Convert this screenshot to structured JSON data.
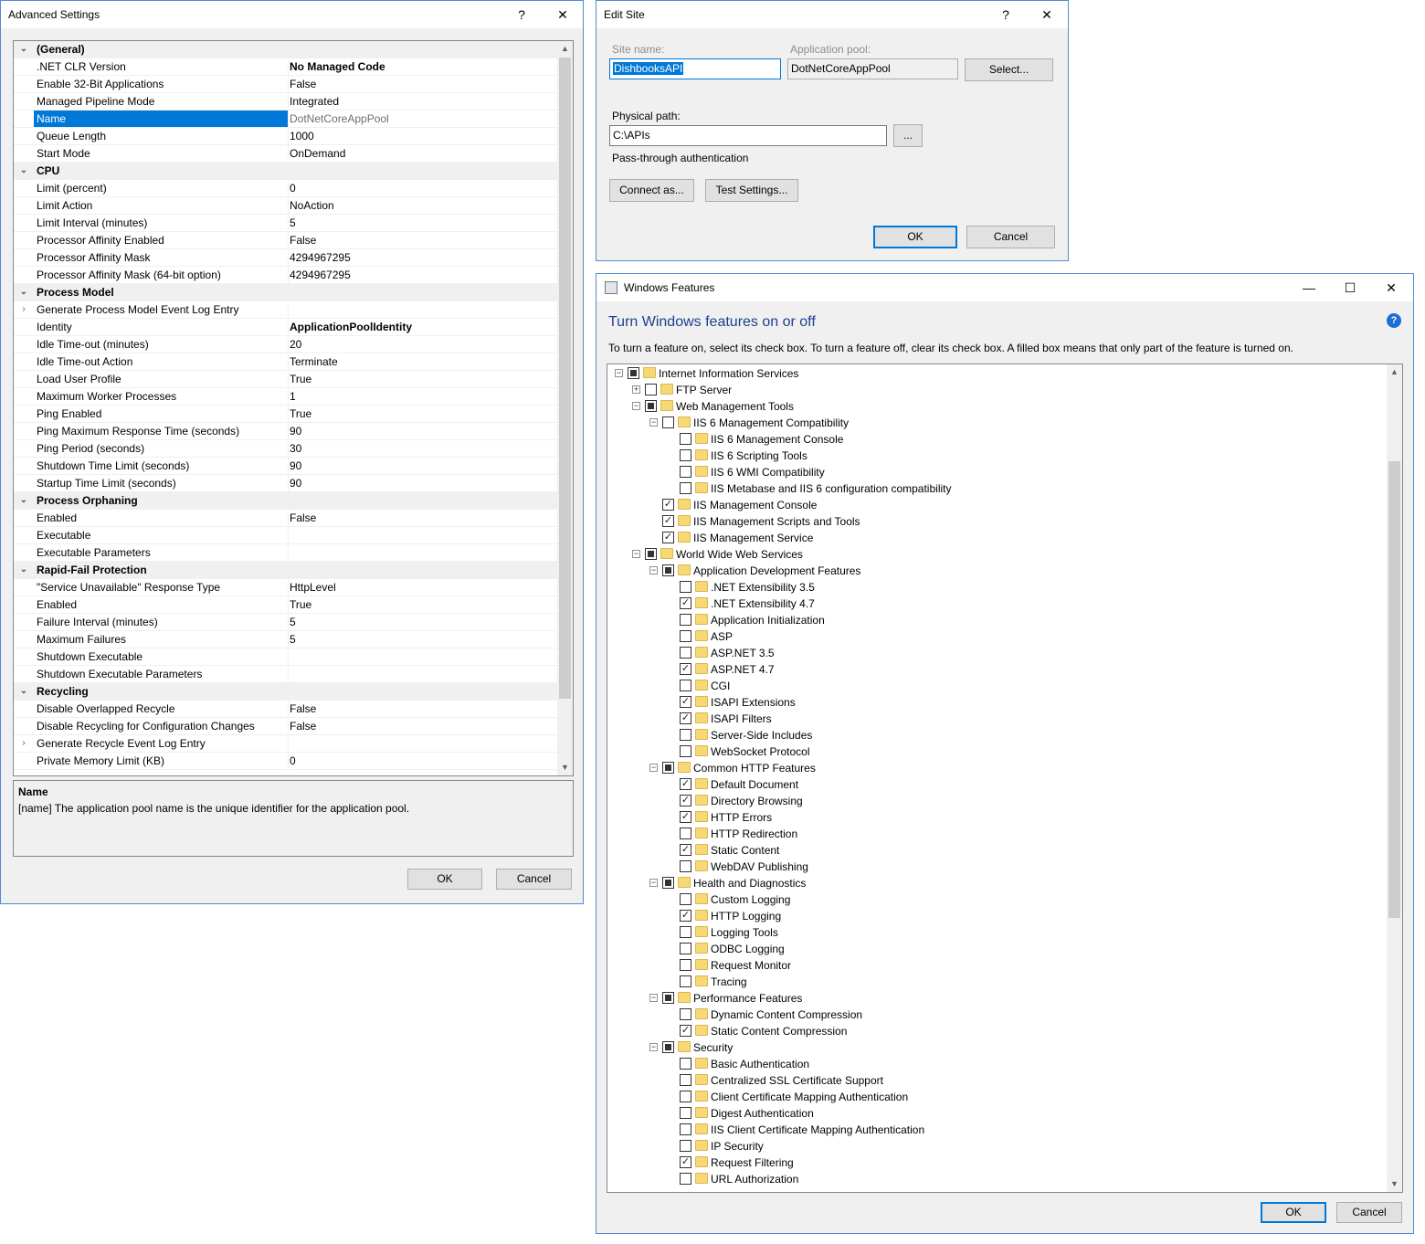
{
  "advanced_settings": {
    "title": "Advanced Settings",
    "help": "?",
    "close": "✕",
    "rows": [
      {
        "type": "cat",
        "name": "(General)"
      },
      {
        "name": ".NET CLR Version",
        "value": "No Managed Code",
        "bold": true
      },
      {
        "name": "Enable 32-Bit Applications",
        "value": "False"
      },
      {
        "name": "Managed Pipeline Mode",
        "value": "Integrated"
      },
      {
        "name": "Name",
        "value": "DotNetCoreAppPool",
        "selected": true
      },
      {
        "name": "Queue Length",
        "value": "1000"
      },
      {
        "name": "Start Mode",
        "value": "OnDemand"
      },
      {
        "type": "cat",
        "name": "CPU"
      },
      {
        "name": "Limit (percent)",
        "value": "0"
      },
      {
        "name": "Limit Action",
        "value": "NoAction"
      },
      {
        "name": "Limit Interval (minutes)",
        "value": "5"
      },
      {
        "name": "Processor Affinity Enabled",
        "value": "False"
      },
      {
        "name": "Processor Affinity Mask",
        "value": "4294967295"
      },
      {
        "name": "Processor Affinity Mask (64-bit option)",
        "value": "4294967295"
      },
      {
        "type": "cat",
        "name": "Process Model"
      },
      {
        "name": "Generate Process Model Event Log Entry",
        "value": "",
        "collapsed": true
      },
      {
        "name": "Identity",
        "value": "ApplicationPoolIdentity",
        "bold": true
      },
      {
        "name": "Idle Time-out (minutes)",
        "value": "20"
      },
      {
        "name": "Idle Time-out Action",
        "value": "Terminate"
      },
      {
        "name": "Load User Profile",
        "value": "True"
      },
      {
        "name": "Maximum Worker Processes",
        "value": "1"
      },
      {
        "name": "Ping Enabled",
        "value": "True"
      },
      {
        "name": "Ping Maximum Response Time (seconds)",
        "value": "90"
      },
      {
        "name": "Ping Period (seconds)",
        "value": "30"
      },
      {
        "name": "Shutdown Time Limit (seconds)",
        "value": "90"
      },
      {
        "name": "Startup Time Limit (seconds)",
        "value": "90"
      },
      {
        "type": "cat",
        "name": "Process Orphaning"
      },
      {
        "name": "Enabled",
        "value": "False"
      },
      {
        "name": "Executable",
        "value": ""
      },
      {
        "name": "Executable Parameters",
        "value": ""
      },
      {
        "type": "cat",
        "name": "Rapid-Fail Protection"
      },
      {
        "name": "\"Service Unavailable\" Response Type",
        "value": "HttpLevel"
      },
      {
        "name": "Enabled",
        "value": "True"
      },
      {
        "name": "Failure Interval (minutes)",
        "value": "5"
      },
      {
        "name": "Maximum Failures",
        "value": "5"
      },
      {
        "name": "Shutdown Executable",
        "value": ""
      },
      {
        "name": "Shutdown Executable Parameters",
        "value": ""
      },
      {
        "type": "cat",
        "name": "Recycling"
      },
      {
        "name": "Disable Overlapped Recycle",
        "value": "False"
      },
      {
        "name": "Disable Recycling for Configuration Changes",
        "value": "False"
      },
      {
        "name": "Generate Recycle Event Log Entry",
        "value": "",
        "collapsed": true
      },
      {
        "name": "Private Memory Limit (KB)",
        "value": "0"
      }
    ],
    "description": {
      "title": "Name",
      "text": "[name] The application pool name is the unique identifier for the application pool."
    },
    "ok_label": "OK",
    "cancel_label": "Cancel"
  },
  "edit_site": {
    "title": "Edit Site",
    "help": "?",
    "close": "✕",
    "site_name_label": "Site name:",
    "site_name_value": "DishbooksAPI",
    "app_pool_label": "Application pool:",
    "app_pool_value": "DotNetCoreAppPool",
    "select_label": "Select...",
    "physical_path_label": "Physical path:",
    "physical_path_value": "C:\\APIs",
    "browse_label": "...",
    "passthrough_label": "Pass-through authentication",
    "connect_as_label": "Connect as...",
    "test_settings_label": "Test Settings...",
    "ok_label": "OK",
    "cancel_label": "Cancel"
  },
  "windows_features": {
    "title": "Windows Features",
    "minimize": "—",
    "maximize": "☐",
    "close": "✕",
    "heading": "Turn Windows features on or off",
    "intro": "To turn a feature on, select its check box. To turn a feature off, clear its check box. A filled box means that only part of the feature is turned on.",
    "help": "?",
    "ok_label": "OK",
    "cancel_label": "Cancel",
    "tree": [
      {
        "level": 0,
        "label": "Internet Information Services",
        "state": "partial",
        "expander": "−"
      },
      {
        "level": 1,
        "label": "FTP Server",
        "state": "unchecked",
        "expander": "+"
      },
      {
        "level": 1,
        "label": "Web Management Tools",
        "state": "partial",
        "expander": "−"
      },
      {
        "level": 2,
        "label": "IIS 6 Management Compatibility",
        "state": "unchecked",
        "expander": "−"
      },
      {
        "level": 3,
        "label": "IIS 6 Management Console",
        "state": "unchecked"
      },
      {
        "level": 3,
        "label": "IIS 6 Scripting Tools",
        "state": "unchecked"
      },
      {
        "level": 3,
        "label": "IIS 6 WMI Compatibility",
        "state": "unchecked"
      },
      {
        "level": 3,
        "label": "IIS Metabase and IIS 6 configuration compatibility",
        "state": "unchecked"
      },
      {
        "level": 2,
        "label": "IIS Management Console",
        "state": "checked"
      },
      {
        "level": 2,
        "label": "IIS Management Scripts and Tools",
        "state": "checked"
      },
      {
        "level": 2,
        "label": "IIS Management Service",
        "state": "checked"
      },
      {
        "level": 1,
        "label": "World Wide Web Services",
        "state": "partial",
        "expander": "−"
      },
      {
        "level": 2,
        "label": "Application Development Features",
        "state": "partial",
        "expander": "−"
      },
      {
        "level": 3,
        "label": ".NET Extensibility 3.5",
        "state": "unchecked"
      },
      {
        "level": 3,
        "label": ".NET Extensibility 4.7",
        "state": "checked"
      },
      {
        "level": 3,
        "label": "Application Initialization",
        "state": "unchecked"
      },
      {
        "level": 3,
        "label": "ASP",
        "state": "unchecked"
      },
      {
        "level": 3,
        "label": "ASP.NET 3.5",
        "state": "unchecked"
      },
      {
        "level": 3,
        "label": "ASP.NET 4.7",
        "state": "checked"
      },
      {
        "level": 3,
        "label": "CGI",
        "state": "unchecked"
      },
      {
        "level": 3,
        "label": "ISAPI Extensions",
        "state": "checked"
      },
      {
        "level": 3,
        "label": "ISAPI Filters",
        "state": "checked"
      },
      {
        "level": 3,
        "label": "Server-Side Includes",
        "state": "unchecked"
      },
      {
        "level": 3,
        "label": "WebSocket Protocol",
        "state": "unchecked"
      },
      {
        "level": 2,
        "label": "Common HTTP Features",
        "state": "partial",
        "expander": "−"
      },
      {
        "level": 3,
        "label": "Default Document",
        "state": "checked"
      },
      {
        "level": 3,
        "label": "Directory Browsing",
        "state": "checked"
      },
      {
        "level": 3,
        "label": "HTTP Errors",
        "state": "checked"
      },
      {
        "level": 3,
        "label": "HTTP Redirection",
        "state": "unchecked"
      },
      {
        "level": 3,
        "label": "Static Content",
        "state": "checked"
      },
      {
        "level": 3,
        "label": "WebDAV Publishing",
        "state": "unchecked"
      },
      {
        "level": 2,
        "label": "Health and Diagnostics",
        "state": "partial",
        "expander": "−"
      },
      {
        "level": 3,
        "label": "Custom Logging",
        "state": "unchecked"
      },
      {
        "level": 3,
        "label": "HTTP Logging",
        "state": "checked"
      },
      {
        "level": 3,
        "label": "Logging Tools",
        "state": "unchecked"
      },
      {
        "level": 3,
        "label": "ODBC Logging",
        "state": "unchecked"
      },
      {
        "level": 3,
        "label": "Request Monitor",
        "state": "unchecked"
      },
      {
        "level": 3,
        "label": "Tracing",
        "state": "unchecked"
      },
      {
        "level": 2,
        "label": "Performance Features",
        "state": "partial",
        "expander": "−"
      },
      {
        "level": 3,
        "label": "Dynamic Content Compression",
        "state": "unchecked"
      },
      {
        "level": 3,
        "label": "Static Content Compression",
        "state": "checked"
      },
      {
        "level": 2,
        "label": "Security",
        "state": "partial",
        "expander": "−"
      },
      {
        "level": 3,
        "label": "Basic Authentication",
        "state": "unchecked"
      },
      {
        "level": 3,
        "label": "Centralized SSL Certificate Support",
        "state": "unchecked"
      },
      {
        "level": 3,
        "label": "Client Certificate Mapping Authentication",
        "state": "unchecked"
      },
      {
        "level": 3,
        "label": "Digest Authentication",
        "state": "unchecked"
      },
      {
        "level": 3,
        "label": "IIS Client Certificate Mapping Authentication",
        "state": "unchecked"
      },
      {
        "level": 3,
        "label": "IP Security",
        "state": "unchecked"
      },
      {
        "level": 3,
        "label": "Request Filtering",
        "state": "checked"
      },
      {
        "level": 3,
        "label": "URL Authorization",
        "state": "unchecked"
      }
    ]
  }
}
